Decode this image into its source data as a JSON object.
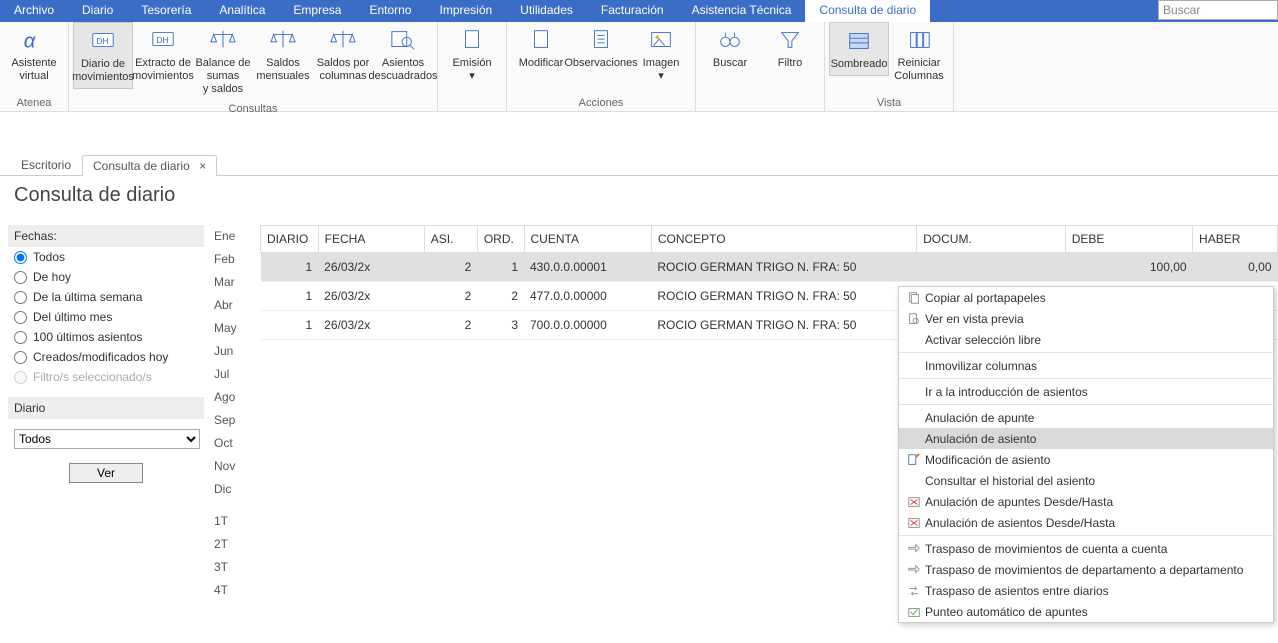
{
  "menus": [
    "Archivo",
    "Diario",
    "Tesorería",
    "Analítica",
    "Empresa",
    "Entorno",
    "Impresión",
    "Utilidades",
    "Facturación",
    "Asistencia Técnica",
    "Consulta de diario"
  ],
  "active_menu": "Consulta de diario",
  "search_placeholder": "Buscar",
  "ribbon": {
    "groups": [
      {
        "label": "Atenea",
        "buttons": [
          {
            "label": "Asistente virtual",
            "icon": "alpha"
          }
        ]
      },
      {
        "label": "Consultas",
        "buttons": [
          {
            "label": "Diario de movimientos",
            "icon": "ledger",
            "active": true
          },
          {
            "label": "Extracto de movimientos",
            "icon": "ledger2"
          },
          {
            "label": "Balance de sumas y saldos",
            "icon": "scales"
          },
          {
            "label": "Saldos mensuales",
            "icon": "scales"
          },
          {
            "label": "Saldos por columnas",
            "icon": "scales"
          },
          {
            "label": "Asientos descuadrados",
            "icon": "magnify"
          }
        ]
      },
      {
        "label": "",
        "buttons": [
          {
            "label": "Emisión ▾",
            "icon": "doc"
          }
        ]
      },
      {
        "label": "Acciones",
        "buttons": [
          {
            "label": "Modificar",
            "icon": "doc"
          },
          {
            "label": "Observaciones",
            "icon": "doc-lines"
          },
          {
            "label": "Imagen ▾",
            "icon": "image"
          }
        ]
      },
      {
        "label": "",
        "buttons": [
          {
            "label": "Buscar",
            "icon": "binoc"
          },
          {
            "label": "Filtro",
            "icon": "funnel"
          }
        ]
      },
      {
        "label": "Vista",
        "buttons": [
          {
            "label": "Sombreado",
            "icon": "shade",
            "active": true
          },
          {
            "label": "Reiniciar Columnas",
            "icon": "cols"
          }
        ]
      }
    ]
  },
  "tabs": {
    "inactive": "Escritorio",
    "active": "Consulta de diario"
  },
  "page_title": "Consulta de diario",
  "fechas": {
    "header": "Fechas:",
    "options": [
      {
        "label": "Todos",
        "checked": true
      },
      {
        "label": "De hoy"
      },
      {
        "label": "De la última semana"
      },
      {
        "label": "Del último mes"
      },
      {
        "label": "100 últimos asientos"
      },
      {
        "label": "Creados/modificados hoy"
      },
      {
        "label": "Filtro/s seleccionado/s",
        "disabled": true
      }
    ],
    "diario_label": "Diario",
    "diario_value": "Todos",
    "ver": "Ver"
  },
  "months": [
    "Ene",
    "Feb",
    "Mar",
    "Abr",
    "May",
    "Jun",
    "Jul",
    "Ago",
    "Sep",
    "Oct",
    "Nov",
    "Dic",
    "",
    "1T",
    "2T",
    "3T",
    "4T"
  ],
  "table": {
    "headers": [
      "DIARIO",
      "FECHA",
      "ASI.",
      "ORD.",
      "CUENTA",
      "CONCEPTO",
      "DOCUM.",
      "DEBE",
      "HABER"
    ],
    "rows": [
      {
        "diario": "1",
        "fecha": "26/03/2x",
        "asi": "2",
        "ord": "1",
        "cuenta": "430.0.0.00001",
        "concepto": "ROCIO GERMAN TRIGO N. FRA:  50",
        "docum": "",
        "debe": "100,00",
        "haber": "0,00",
        "selected": true
      },
      {
        "diario": "1",
        "fecha": "26/03/2x",
        "asi": "2",
        "ord": "2",
        "cuenta": "477.0.0.00000",
        "concepto": "ROCIO GERMAN TRIGO N. FRA:  50",
        "docum": "",
        "debe": "",
        "haber": ""
      },
      {
        "diario": "1",
        "fecha": "26/03/2x",
        "asi": "2",
        "ord": "3",
        "cuenta": "700.0.0.00000",
        "concepto": "ROCIO GERMAN TRIGO N. FRA:  50",
        "docum": "",
        "debe": "",
        "haber": ""
      }
    ]
  },
  "ctx": [
    {
      "label": "Copiar al portapapeles",
      "icon": "copy"
    },
    {
      "label": "Ver en vista previa",
      "icon": "preview"
    },
    {
      "label": "Activar selección libre"
    },
    {
      "sep": true
    },
    {
      "label": "Inmovilizar columnas"
    },
    {
      "sep": true
    },
    {
      "label": "Ir a la introducción de asientos"
    },
    {
      "sep": true
    },
    {
      "label": "Anulación de apunte"
    },
    {
      "label": "Anulación de asiento",
      "hover": true
    },
    {
      "label": "Modificación de asiento",
      "icon": "edit"
    },
    {
      "label": "Consultar el historial del asiento"
    },
    {
      "label": "Anulación de apuntes Desde/Hasta",
      "icon": "delrow"
    },
    {
      "label": "Anulación de asientos Desde/Hasta",
      "icon": "delrow"
    },
    {
      "sep": true
    },
    {
      "label": "Traspaso de movimientos de cuenta a cuenta",
      "icon": "transfer"
    },
    {
      "label": "Traspaso de movimientos de departamento a departamento",
      "icon": "transfer"
    },
    {
      "label": "Traspaso de asientos entre diarios",
      "icon": "swap"
    },
    {
      "label": "Punteo automático de apuntes",
      "icon": "check"
    }
  ]
}
